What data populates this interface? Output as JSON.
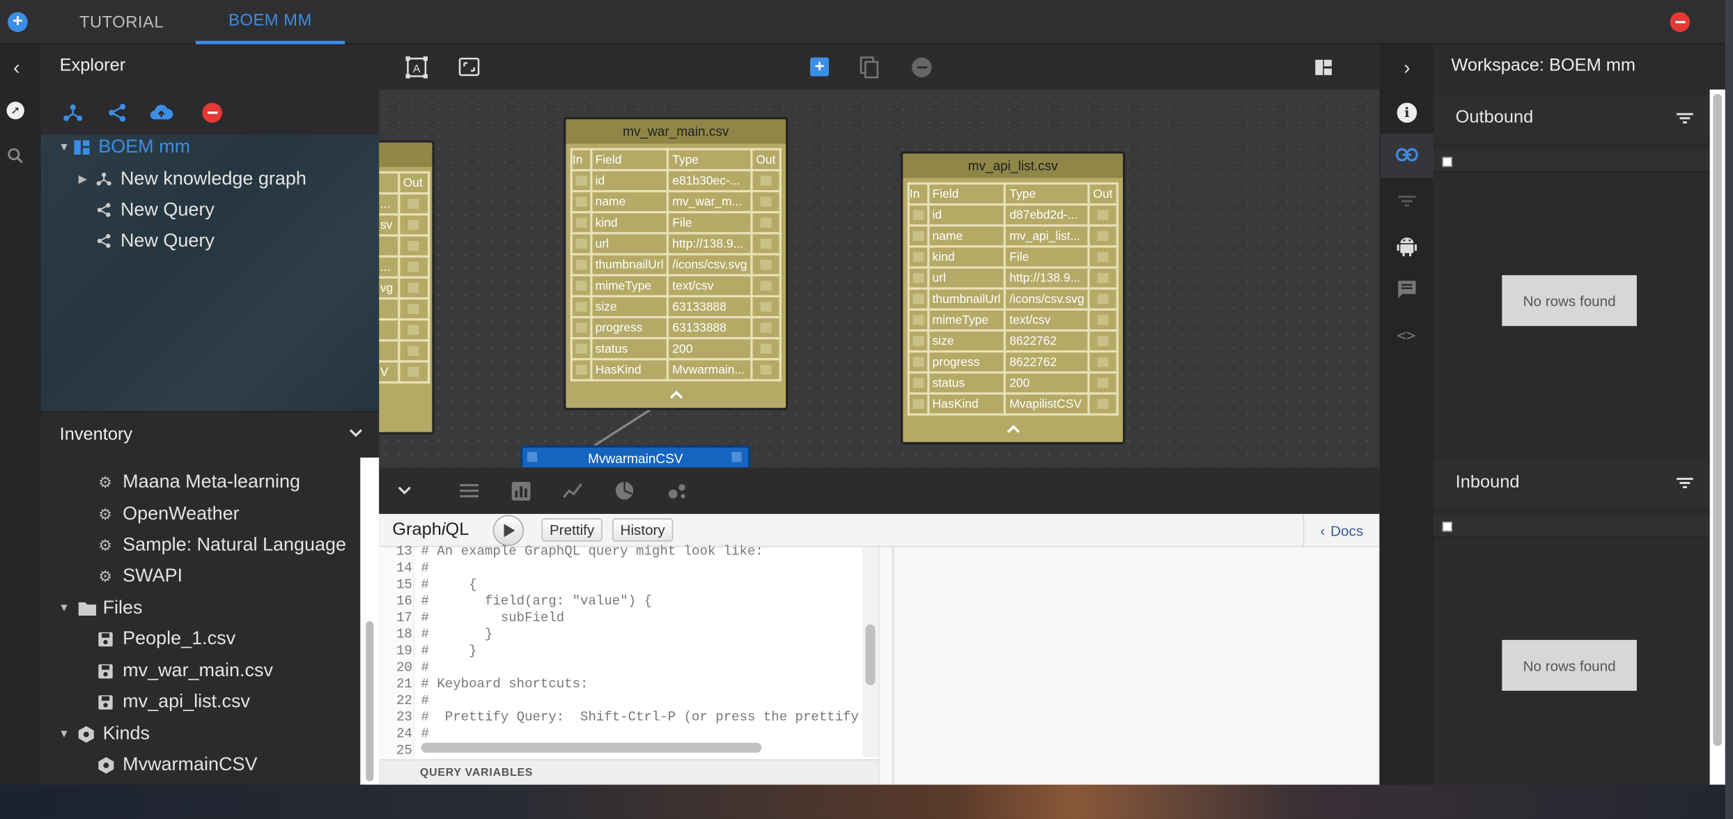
{
  "tabs": [
    {
      "label": "TUTORIAL"
    },
    {
      "label": "BOEM MM"
    }
  ],
  "colors": {
    "accent": "#3b8ee8",
    "danger": "#e53935",
    "node": "#b4aa66",
    "node_header": "#8f8647",
    "instance": "#1565c0"
  },
  "explorer": {
    "title": "Explorer",
    "tree": [
      {
        "label": "BOEM mm",
        "icon": "workspace-icon"
      },
      {
        "label": "New knowledge graph",
        "icon": "graph-icon"
      },
      {
        "label": "New Query",
        "icon": "share-icon"
      },
      {
        "label": "New Query",
        "icon": "share-icon"
      }
    ]
  },
  "inventory": {
    "title": "Inventory",
    "services": [
      "Maana Meta-learning",
      "OpenWeather",
      "Sample: Natural Language",
      "SWAPI"
    ],
    "files_label": "Files",
    "files": [
      "People_1.csv",
      "mv_war_main.csv",
      "mv_api_list.csv"
    ],
    "kinds_label": "Kinds",
    "kinds": [
      "MvwarmainCSV"
    ]
  },
  "nodes": {
    "partial": {
      "out": "Out",
      "cells": [
        "...",
        "sv",
        "",
        "...",
        "vg",
        "",
        "",
        "",
        "V"
      ]
    },
    "war": {
      "title": "mv_war_main.csv",
      "headers": [
        "In",
        "Field",
        "Type",
        "Out"
      ],
      "rows": [
        {
          "field": "id",
          "type": "e81b30ec-..."
        },
        {
          "field": "name",
          "type": "mv_war_m..."
        },
        {
          "field": "kind",
          "type": "File"
        },
        {
          "field": "url",
          "type": "http://138.9..."
        },
        {
          "field": "thumbnailUrl",
          "type": "/icons/csv.svg"
        },
        {
          "field": "mimeType",
          "type": "text/csv"
        },
        {
          "field": "size",
          "type": "63133888"
        },
        {
          "field": "progress",
          "type": "63133888"
        },
        {
          "field": "status",
          "type": "200"
        },
        {
          "field": "HasKind",
          "type": "Mvwarmain..."
        }
      ]
    },
    "api": {
      "title": "mv_api_list.csv",
      "headers": [
        "In",
        "Field",
        "Type",
        "Out"
      ],
      "rows": [
        {
          "field": "id",
          "type": "d87ebd2d-..."
        },
        {
          "field": "name",
          "type": "mv_api_list..."
        },
        {
          "field": "kind",
          "type": "File"
        },
        {
          "field": "url",
          "type": "http://138.9..."
        },
        {
          "field": "thumbnailUrl",
          "type": "/icons/csv.svg"
        },
        {
          "field": "mimeType",
          "type": "text/csv"
        },
        {
          "field": "size",
          "type": "8622762"
        },
        {
          "field": "progress",
          "type": "8622762"
        },
        {
          "field": "status",
          "type": "200"
        },
        {
          "field": "HasKind",
          "type": "MvapilistCSV"
        }
      ]
    },
    "kind_node": {
      "title": "MvwarmainCSV"
    }
  },
  "graphiql": {
    "title_a": "Graph",
    "title_b": "i",
    "title_c": "QL",
    "prettify": "Prettify",
    "history": "History",
    "docs": "Docs",
    "query_variables": "QUERY VARIABLES",
    "lines": [
      {
        "n": "13",
        "t": "# An example GraphQL query might look like:"
      },
      {
        "n": "14",
        "t": "#"
      },
      {
        "n": "15",
        "t": "#     {"
      },
      {
        "n": "16",
        "t": "#       field(arg: \"value\") {"
      },
      {
        "n": "17",
        "t": "#         subField"
      },
      {
        "n": "18",
        "t": "#       }"
      },
      {
        "n": "19",
        "t": "#     }"
      },
      {
        "n": "20",
        "t": "#"
      },
      {
        "n": "21",
        "t": "# Keyboard shortcuts:"
      },
      {
        "n": "22",
        "t": "#"
      },
      {
        "n": "23",
        "t": "#  Prettify Query:  Shift-Ctrl-P (or press the prettify bu"
      },
      {
        "n": "24",
        "t": "#"
      },
      {
        "n": "25",
        "t": ""
      }
    ]
  },
  "workspace": {
    "title": "Workspace: BOEM mm",
    "outbound": "Outbound",
    "inbound": "Inbound",
    "no_rows": "No rows found"
  }
}
